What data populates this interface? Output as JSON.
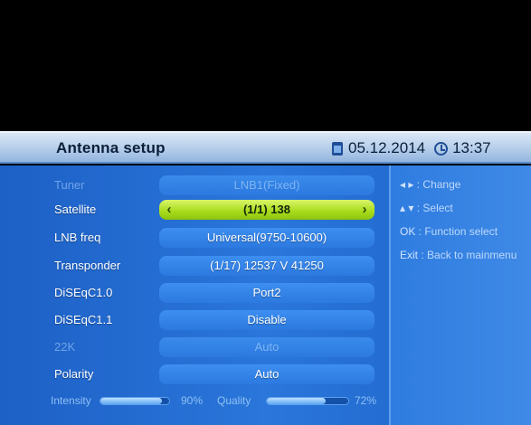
{
  "header": {
    "title": "Antenna setup",
    "date": "05.12.2014",
    "time": "13:37"
  },
  "menu": [
    {
      "label": "Tuner",
      "value": "LNB1(Fixed)",
      "state": "disabled"
    },
    {
      "label": "Satellite",
      "value": "(1/1) 138",
      "state": "selected"
    },
    {
      "label": "LNB freq",
      "value": "Universal(9750-10600)",
      "state": "normal"
    },
    {
      "label": "Transponder",
      "value": "(1/17) 12537 V 41250",
      "state": "normal"
    },
    {
      "label": "DiSEqC1.0",
      "value": "Port2",
      "state": "normal"
    },
    {
      "label": "DiSEqC1.1",
      "value": "Disable",
      "state": "normal"
    },
    {
      "label": "22K",
      "value": "Auto",
      "state": "disabled"
    },
    {
      "label": "Polarity",
      "value": "Auto",
      "state": "normal"
    }
  ],
  "signal": {
    "intensity_label": "Intensity",
    "intensity_text": "90%",
    "intensity_value": 0.9,
    "quality_label": "Quality",
    "quality_text": "72%",
    "quality_value": 0.72
  },
  "help": [
    {
      "key": "◂ ▸",
      "text": ": Change"
    },
    {
      "key": "▴ ▾",
      "text": ": Select"
    },
    {
      "key": "OK",
      "text": ": Function select"
    },
    {
      "key": "Exit",
      "text": ": Back to mainmenu"
    }
  ],
  "colors": {
    "header_bar": "#bcd2ec",
    "panel_blue": "#2a76da",
    "selected_green": "#a7da1a"
  },
  "icons": {
    "date": "calendar-icon",
    "time": "clock-icon"
  }
}
